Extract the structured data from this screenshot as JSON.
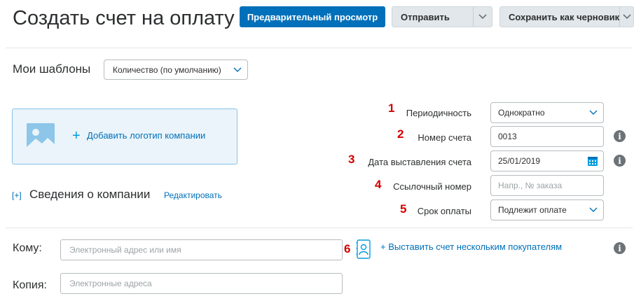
{
  "header": {
    "title": "Создать счет на оплату",
    "preview_label": "Предварительный просмотр",
    "send_label": "Отправить",
    "save_draft_label": "Сохранить как черновик"
  },
  "templates": {
    "label": "Мои шаблоны",
    "selected": "Количество (по умолчанию)"
  },
  "logo": {
    "add_label": "Добавить логотип компании",
    "plus": "+"
  },
  "company": {
    "toggle": "[+]",
    "label": "Сведения о компании",
    "edit_label": "Редактировать"
  },
  "invoice_fields": {
    "frequency": {
      "number": "1",
      "label": "Периодичность",
      "value": "Однократно"
    },
    "invoice_number": {
      "number": "2",
      "label": "Номер счета",
      "value": "0013"
    },
    "invoice_date": {
      "number": "3",
      "label": "Дата выставления счета",
      "value": "25/01/2019"
    },
    "reference": {
      "number": "4",
      "label": "Ссылочный номер",
      "placeholder": "Напр., № заказа"
    },
    "due": {
      "number": "5",
      "label": "Срок оплаты",
      "value": "Подлежит оплате"
    }
  },
  "recipients": {
    "to_label": "Кому:",
    "to_placeholder": "Электронный адрес или имя",
    "contacts_number": "6",
    "multi_label": "+ Выставить счет нескольким покупателям",
    "cc_label": "Копия:",
    "cc_placeholder": "Электронные адреса"
  },
  "icons": {
    "info": "i",
    "chevron": "chevron-down-icon",
    "calendar": "calendar-icon",
    "contact_book": "contact-book-icon",
    "image": "image-icon"
  },
  "colors": {
    "primary": "#0070ba",
    "link": "#0070ba",
    "annotation": "#d20000",
    "info_icon": "#6c7378"
  }
}
